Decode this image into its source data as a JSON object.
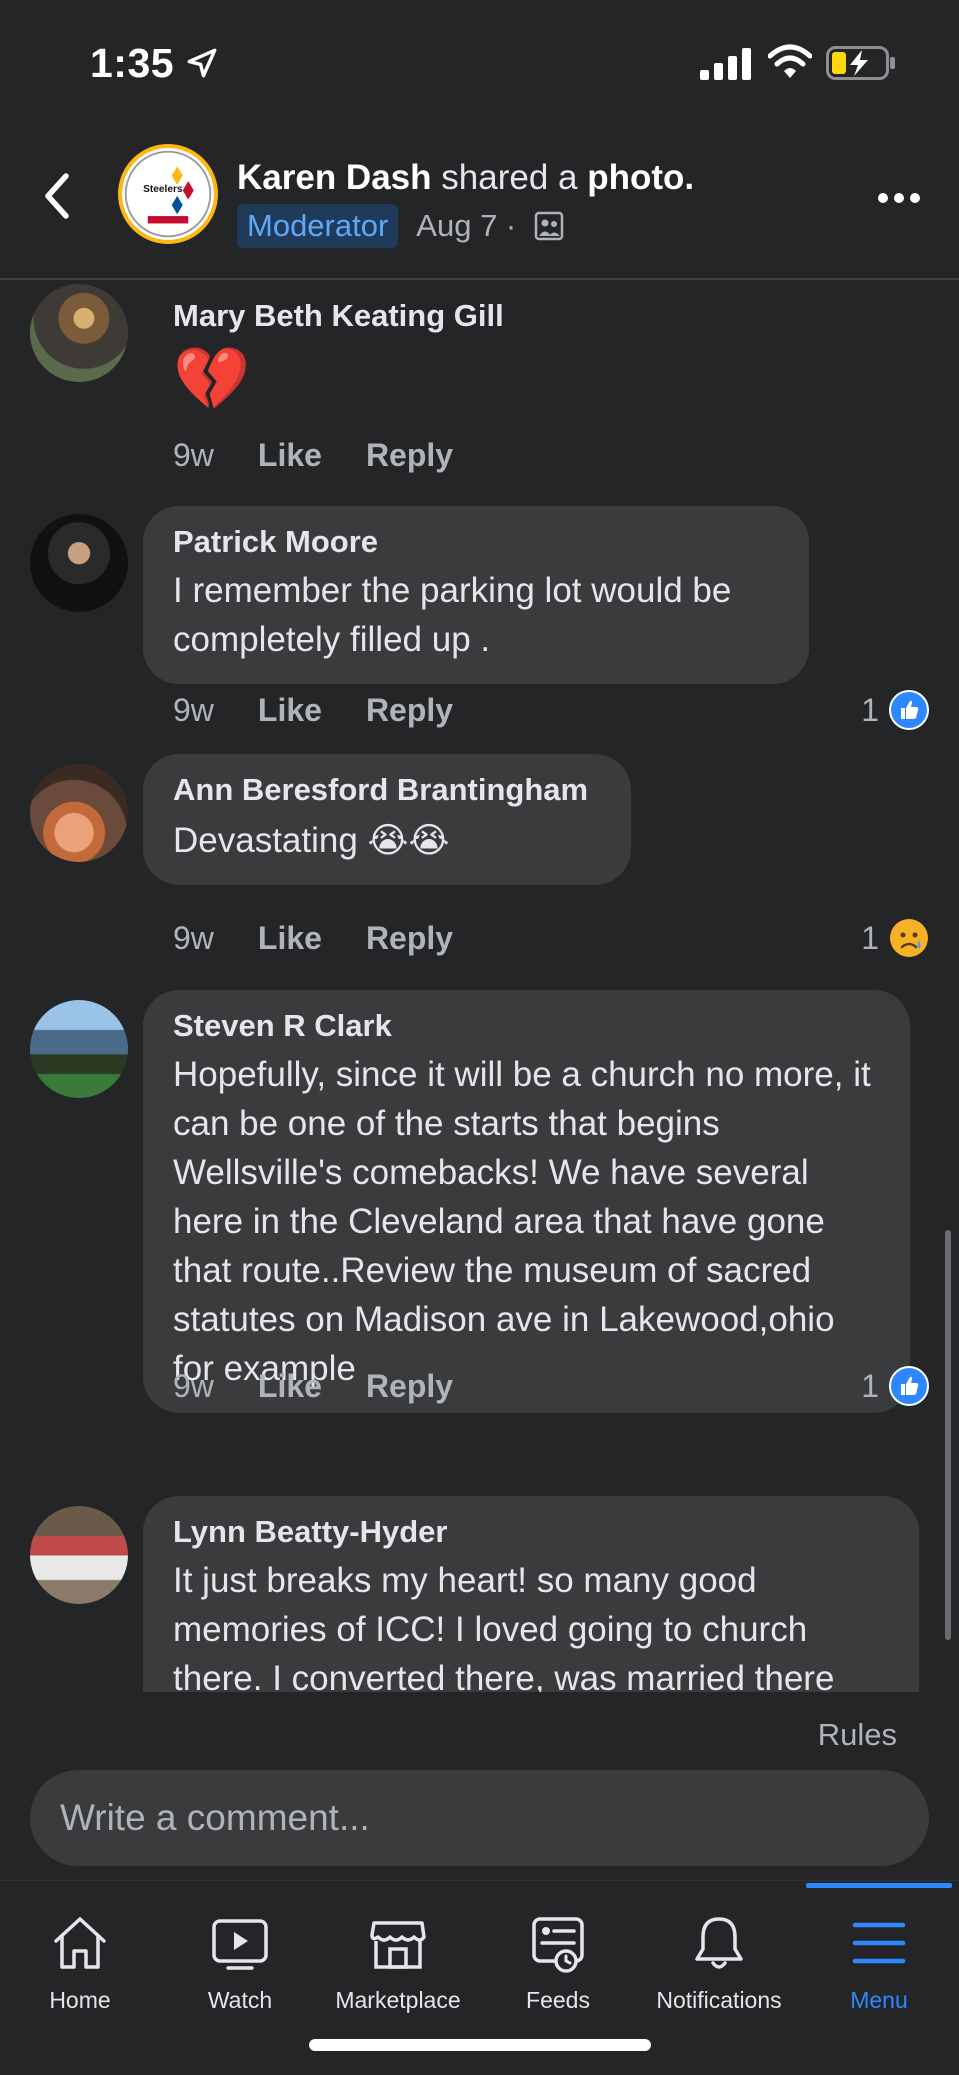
{
  "status_bar": {
    "time": "1:35"
  },
  "header": {
    "author": "Karen Dash",
    "action": "shared a",
    "object": "photo.",
    "badge": "Moderator",
    "date": "Aug 7 ·",
    "logo_text": "Steelers"
  },
  "comments": [
    {
      "name": "Mary Beth Keating Gill",
      "text": "💔",
      "time": "9w",
      "like": "Like",
      "reply": "Reply",
      "reaction_count": "",
      "reaction": ""
    },
    {
      "name": "Patrick Moore",
      "text": "I remember the parking lot would be completely filled up .",
      "time": "9w",
      "like": "Like",
      "reply": "Reply",
      "reaction_count": "1",
      "reaction": "like"
    },
    {
      "name": "Ann Beresford Brantingham",
      "text": "Devastating 😭😭",
      "time": "9w",
      "like": "Like",
      "reply": "Reply",
      "reaction_count": "1",
      "reaction": "sad"
    },
    {
      "name": "Steven R Clark",
      "text": "Hopefully, since it will be a church no more, it can be one of the starts that begins Wellsville's comebacks!  We have several here in the Cleveland area that have gone that route..Review the museum of sacred statutes on Madison ave in Lakewood,ohio for example",
      "time": "9w",
      "like": "Like",
      "reply": "Reply",
      "reaction_count": "1",
      "reaction": "like"
    },
    {
      "name": "Lynn Beatty-Hyder",
      "text": "It just breaks my heart! so many good memories of ICC! I loved going to church there. I converted there, was married there",
      "time": "",
      "like": "",
      "reply": "",
      "reaction_count": "",
      "reaction": ""
    }
  ],
  "composer": {
    "rules": "Rules",
    "placeholder": "Write a comment..."
  },
  "tabs": [
    {
      "label": "Home",
      "icon": "home-icon"
    },
    {
      "label": "Watch",
      "icon": "watch-icon"
    },
    {
      "label": "Marketplace",
      "icon": "marketplace-icon"
    },
    {
      "label": "Feeds",
      "icon": "feeds-icon"
    },
    {
      "label": "Notifications",
      "icon": "bell-icon"
    },
    {
      "label": "Menu",
      "icon": "menu-icon",
      "active": true
    }
  ],
  "colors": {
    "background": "#242526",
    "bubble": "#3a3b3c",
    "accent": "#2d88ff",
    "secondary_text": "#b0b3b8"
  }
}
